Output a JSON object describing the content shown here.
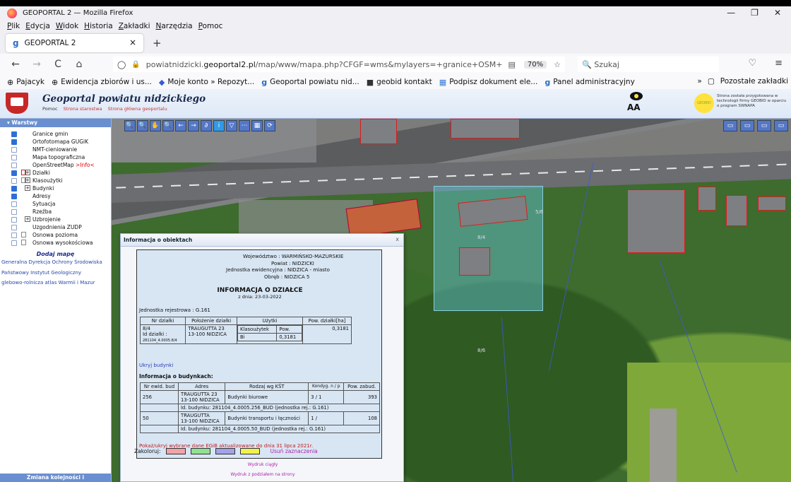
{
  "window": {
    "title": "GEOPORTAL 2 — Mozilla Firefox",
    "controls": [
      "—",
      "❐",
      "✕"
    ]
  },
  "menu": [
    "Plik",
    "Edycja",
    "Widok",
    "Historia",
    "Zakładki",
    "Narzędzia",
    "Pomoc"
  ],
  "tab": {
    "title": "GEOPORTAL 2",
    "close": "×",
    "new": "+"
  },
  "nav": {
    "back": "←",
    "forward": "→",
    "reload": "C",
    "home": "⌂",
    "url_prefix": "powiatnidzicki.",
    "url_domain": "geoportal2.pl",
    "url_path": "/map/www/mapa.php?CFGF=wms&mylayers=+granice+OSM+",
    "zoom": "70%",
    "search_placeholder": "Szukaj"
  },
  "bookmarks": [
    "Pajacyk",
    "Ewidencja zbiorów i us...",
    "Moje konto » Repozyt...",
    "Geoportal powiatu nid...",
    "geobid kontakt",
    "Podpisz dokument ele...",
    "Panel administracyjny"
  ],
  "bookmarks_other": "Pozostałe zakładki",
  "bookmarks_more": "»",
  "banner": {
    "title": "Geoportal powiatu nidzickiego",
    "links": [
      "Pomoc",
      "Strona starostwa",
      "Strona główna geoportalu"
    ],
    "aa": "AA",
    "geobid": "GEOBID",
    "note": "Strona została przygotowana w technologii firmy GEOBID w oparciu o program SWNAPA"
  },
  "sidebar": {
    "header": "Warstwy",
    "layers": [
      {
        "label": "Granice gmin",
        "checked": true
      },
      {
        "label": "Ortofotomapa GUGiK",
        "checked": true
      },
      {
        "label": "NMT-cieniowanie",
        "checked": false
      },
      {
        "label": "Mapa topograficzna",
        "checked": false
      },
      {
        "label": "OpenStreetMap",
        "checked": false,
        "suffix": ">Info<"
      },
      {
        "label": "Działki",
        "checked": true,
        "expand": "+"
      },
      {
        "label": "Klasoużytki",
        "checked": false,
        "expand": "+"
      },
      {
        "label": "Budynki",
        "checked": true,
        "expand": "+"
      },
      {
        "label": "Adresy",
        "checked": true
      },
      {
        "label": "Sytuacja",
        "checked": false
      },
      {
        "label": "Rzeźba",
        "checked": false
      },
      {
        "label": "Uzbrojenie",
        "checked": false,
        "expand": "+"
      },
      {
        "label": "Uzgodnienia ZUDP",
        "checked": false
      },
      {
        "label": "Osnowa pozioma",
        "checked": false
      },
      {
        "label": "Osnowa wysokościowa",
        "checked": false
      }
    ],
    "add_map": "Dodaj mapę",
    "sources": [
      "Generalna Dyrekcja Ochrony Środowiska",
      "Państwowy Instytut Geologiczny",
      "glebowo-rolnicza atlas Warmii i Mazur"
    ],
    "footer": "Zmiana kolejności i"
  },
  "map_tools": [
    "🔍",
    "🔍",
    "✋",
    "🔍",
    "←",
    "→",
    "∂",
    "i",
    "▽",
    "⋯",
    "▦",
    "⟳"
  ],
  "view_tools": [
    "▭",
    "▭",
    "▭",
    "▭"
  ],
  "map_labels": [
    "8/4",
    "5/6",
    "8/6"
  ],
  "dialog": {
    "title": "Informacja o obiektach",
    "close": "x",
    "address": {
      "woj": "Województwo : WARMIŃSKO-MAZURSKIE",
      "pow": "Powiat : NIDZICKI",
      "jedn": "Jednostka ewidencyjna : NIDZICA - miasto",
      "obreb": "Obręb : NIDZICA 5"
    },
    "heading": "INFORMACJA O DZIAŁCE",
    "date": "z dnia: 23-03-2022",
    "jr": "Jednostka rejestrowa : G.161",
    "parcel_headers": [
      "Nr działki",
      "Położenie działki",
      "Użytki",
      "Pow. działki[ha]"
    ],
    "parcel": {
      "nr": "8/4",
      "id_label": "Id działki :",
      "id": "281104_4.0005.8/4",
      "loc1": "TRAUGUTTA 23",
      "loc2": "13-100 NIDZICA",
      "uz_head": "Klasoużytek",
      "pow_head": "Pow.",
      "uz": "Bi",
      "uz_pow": "0,3181",
      "pow": "0,3181"
    },
    "hide_buildings": "Ukryj budynki",
    "building_info": "Informacja o budynkach:",
    "bld_headers": [
      "Nr ewid. bud",
      "Adres",
      "Rodzaj wg KŚT",
      "Kondyg. n / p",
      "Pow. zabud."
    ],
    "buildings": [
      {
        "nr": "256",
        "addr1": "TRAUGUTTA 23",
        "addr2": "13-100 NIDZICA",
        "type": "Budynki biurowe",
        "kond": "3 / 1",
        "pow": "393",
        "id_label": "Id. budynku:",
        "id": "281104_4.0005.256_BUD",
        "jr": "(jednostka rej.: G.161)"
      },
      {
        "nr": "50",
        "addr1": "TRAUGUTTA",
        "addr2": "13-100 NIDZICA",
        "type": "Budynki transportu i łączności",
        "kond": "1 /",
        "pow": "108",
        "id_label": "Id. budynku:",
        "id": "281104_4.0005.50_BUD",
        "jr": "(jednostka rej.: G.161)"
      }
    ],
    "egib": "Pokaż/ukryj wybrane dane EGiB aktualizowane do dnia 31 lipca 2021r.",
    "color_label": "Zakoloruj:",
    "swatches": [
      "#f3a3a8",
      "#8fe38f",
      "#a4a2e8",
      "#f2f24a"
    ],
    "clear": "Usuń zaznaczenia",
    "print": "Wydruk ciągły",
    "print_pages": "Wydruk z podziałem na strony"
  }
}
